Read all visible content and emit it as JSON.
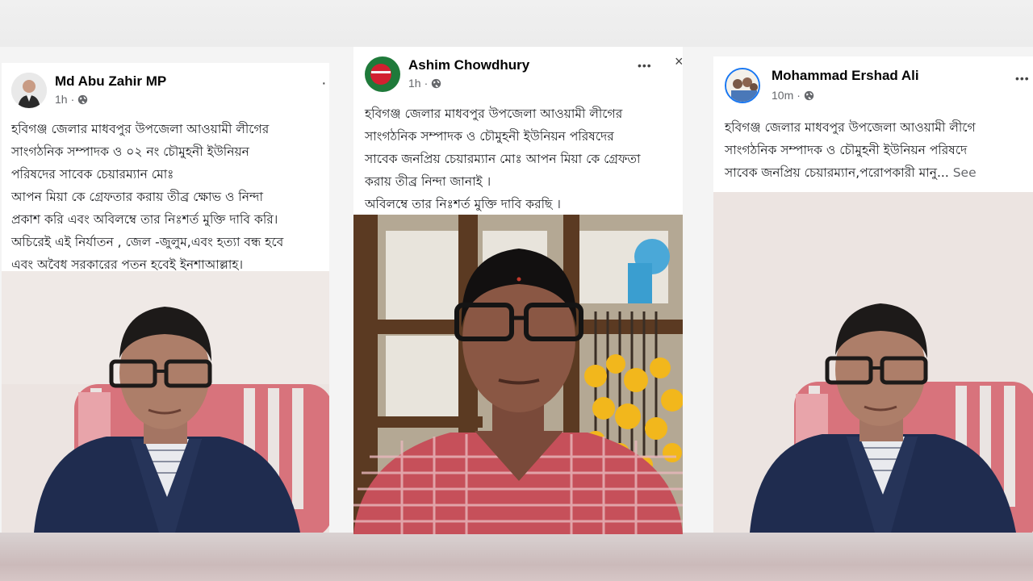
{
  "posts": [
    {
      "author": "Md Abu Zahir MP",
      "time": "1h",
      "audience_icon": "globe-icon",
      "lines": [
        "হবিগঞ্জ জেলার মাধবপুর উপজেলা আওয়ামী লীগের",
        "সাংগঠনিক সম্পাদক ও ০২ নং চৌমুহনী ইউনিয়ন",
        "পরিষদের সাবেক চেয়ারম্যান মোঃ",
        "আপন মিয়া কে গ্রেফতার করায় তীব্র ক্ষোভ ও নিন্দা",
        "প্রকাশ করি এবং অবিলম্বে তার নিঃশর্ত মুক্তি দাবি করি।",
        "অচিরেই এই নির্যাতন , জেল -জুলুম,এবং  হত্যা বন্ধ হবে",
        "এবং অবৈধ সরকারের পতন হবেই ইনশাআল্লাহ।"
      ]
    },
    {
      "author": "Ashim Chowdhury",
      "time": "1h",
      "audience_icon": "globe-icon",
      "lines": [
        "হবিগঞ্জ জেলার মাধবপুর উপজেলা আওয়ামী লীগের",
        "সাংগঠনিক সম্পাদক ও চৌমুহনী ইউনিয়ন পরিষদের",
        "সাবেক জনপ্রিয় চেয়ারম্যান মোঃ আপন মিয়া কে গ্রেফতা",
        "করায় তীব্র  নিন্দা জানাই ।",
        "অবিলম্বে তার নিঃশর্ত মুক্তি দাবি করছি ।"
      ],
      "more_label": "•••",
      "close_label": "×"
    },
    {
      "author": "Mohammad Ershad Ali",
      "time": "10m",
      "audience_icon": "globe-icon",
      "lines": [
        "হবিগঞ্জ জেলার মাধবপুর উপজেলা আওয়ামী লীগে",
        "সাংগঠনিক সম্পাদক ও চৌমুহনী ইউনিয়ন পরিষদে",
        "সাবেক জনপ্রিয় চেয়ারম্যান,পরোপকারী মানু..."
      ],
      "see_more_label": "See",
      "more_label": "•••"
    }
  ],
  "colors": {
    "post_bg": "#ffffff",
    "meta_text": "#65676b",
    "page_bg": "#f4f4f4"
  }
}
